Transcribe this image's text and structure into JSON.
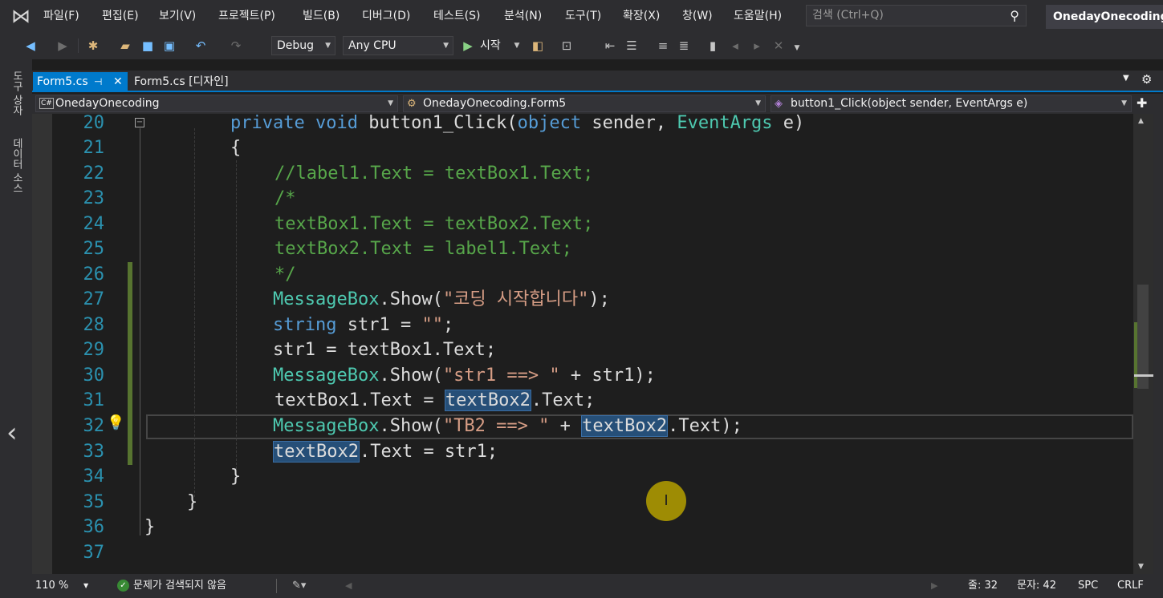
{
  "app": {
    "solution_name": "OnedayOnecoding"
  },
  "menu": [
    "파일(F)",
    "편집(E)",
    "보기(V)",
    "프로젝트(P)",
    "빌드(B)",
    "디버그(D)",
    "테스트(S)",
    "분석(N)",
    "도구(T)",
    "확장(X)",
    "창(W)",
    "도움말(H)"
  ],
  "search": {
    "placeholder": "검색 (Ctrl+Q)"
  },
  "toolbar": {
    "config": "Debug",
    "platform": "Any CPU",
    "start_label": "시작"
  },
  "left_strip": {
    "toolbox": "도구 상자",
    "datasource": "데이터 소스"
  },
  "tabs": {
    "active": "Form5.cs",
    "inactive": "Form5.cs [디자인]"
  },
  "navbar": {
    "project": "OnedayOnecoding",
    "class": "OnedayOnecoding.Form5",
    "member": "button1_Click(object sender, EventArgs e)"
  },
  "code": {
    "line_numbers": [
      "20",
      "21",
      "22",
      "23",
      "24",
      "25",
      "26",
      "27",
      "28",
      "29",
      "30",
      "31",
      "32",
      "33",
      "34",
      "35",
      "36",
      "37"
    ],
    "l20": {
      "kw1": "private",
      "kw2": "void",
      "method": "button1_Click",
      "open": "(",
      "kw3": "object",
      "p1": " sender, ",
      "cls": "EventArgs",
      "p2": " e)"
    },
    "l21": "{",
    "l22": "//label1.Text = textBox1.Text;",
    "l23": "/*",
    "l24": "textBox1.Text = textBox2.Text;",
    "l25": "textBox2.Text = label1.Text;",
    "l26": "*/",
    "l27": {
      "cls": "MessageBox",
      "mid": ".Show(",
      "str": "\"코딩 시작합니다\"",
      "end": ");"
    },
    "l28": {
      "kw": "string",
      "rest": " str1 = ",
      "str": "\"\"",
      "end": ";"
    },
    "l29": "str1 = textBox1.Text;",
    "l30": {
      "cls": "MessageBox",
      "mid": ".Show(",
      "str": "\"str1 ==> \"",
      "end": " + str1);"
    },
    "l31": {
      "pre": "textBox1.Text = ",
      "hl": "textBox2",
      "end": ".Text;"
    },
    "l32": {
      "cls": "MessageBox",
      "mid": ".Show(",
      "str": "\"TB2 ==> \"",
      "mid2": " + ",
      "hl": "textBox2",
      "end": ".Text);"
    },
    "l33": {
      "hl": "textBox2",
      "end": ".Text = str1;"
    },
    "l34": "}",
    "l35": "}",
    "l36": "}"
  },
  "status": {
    "zoom": "110 %",
    "issues": "문제가 검색되지 않음",
    "line": "줄: 32",
    "col": "문자: 42",
    "spc": "SPC",
    "eol": "CRLF"
  }
}
